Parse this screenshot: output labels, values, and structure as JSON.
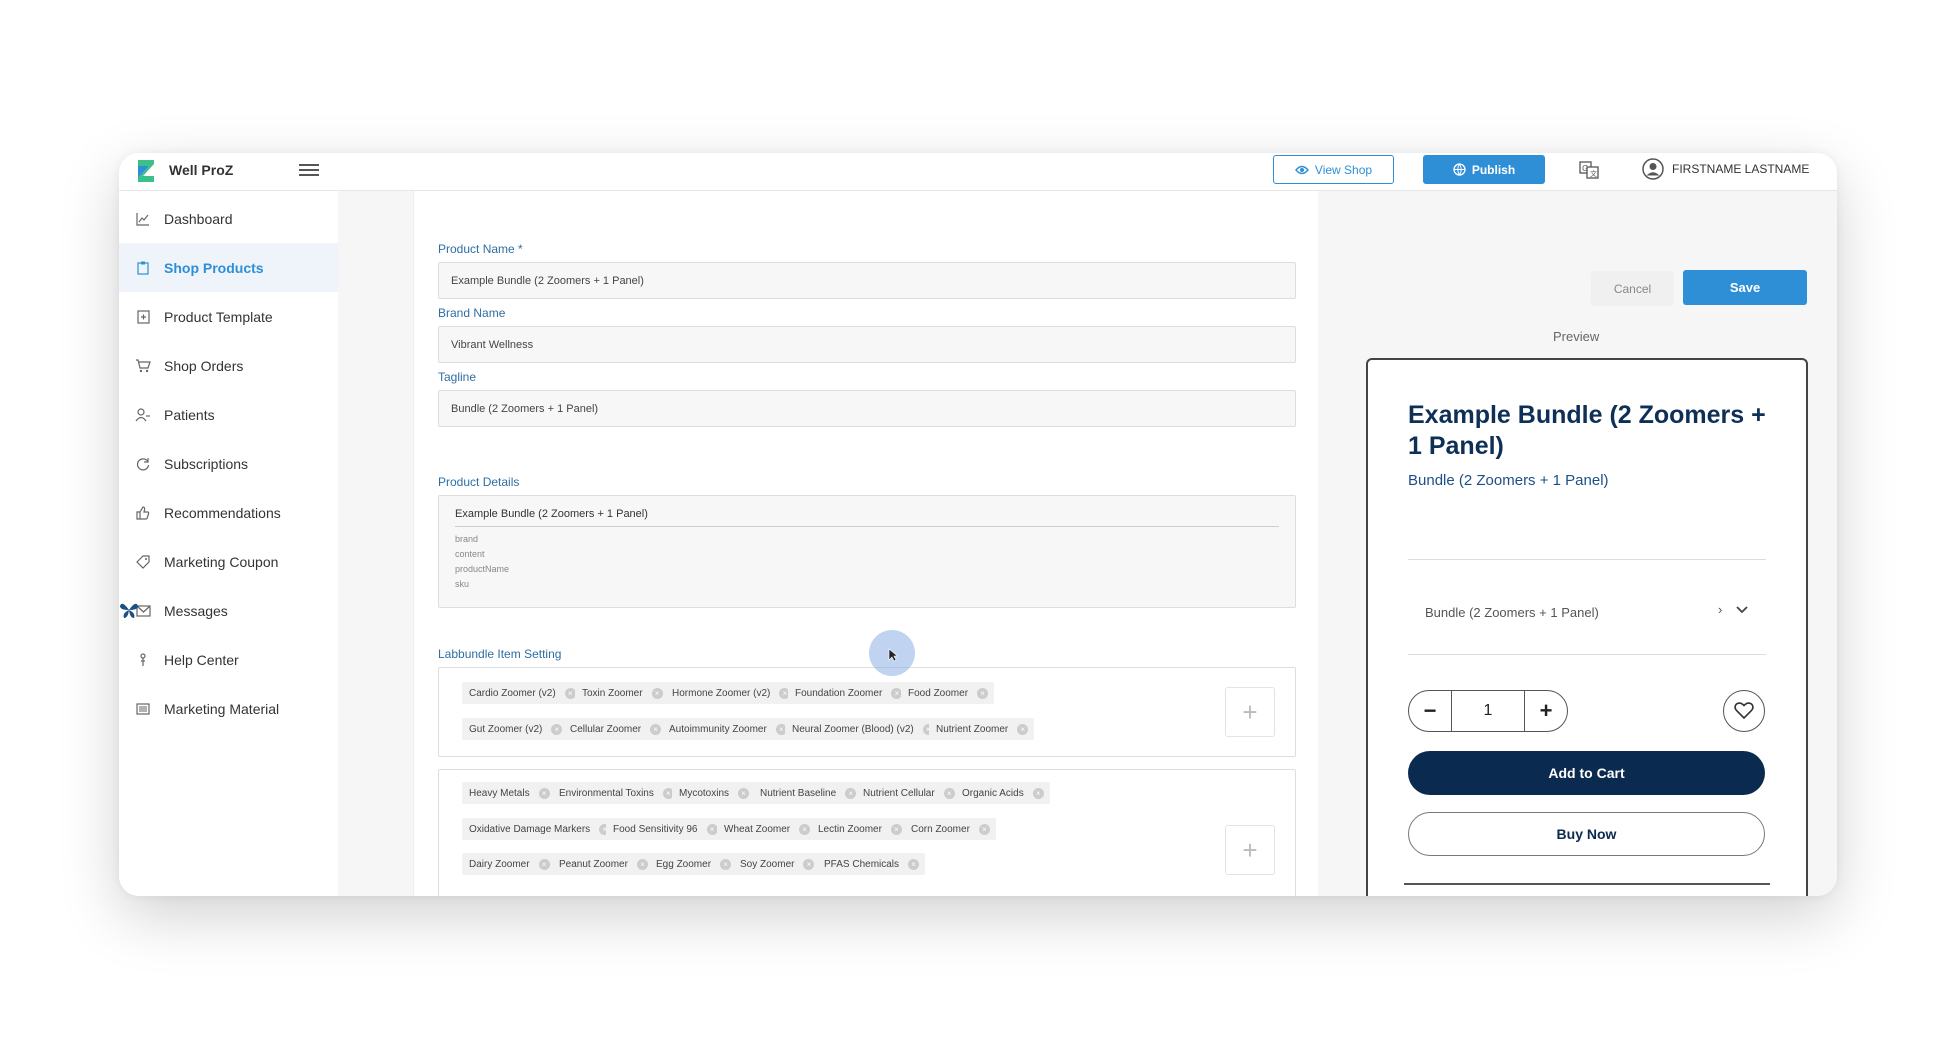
{
  "app": {
    "name": "Well ProZ"
  },
  "topbar": {
    "view_shop": "View Shop",
    "publish": "Publish",
    "user_name": "FIRSTNAME LASTNAME"
  },
  "sidebar": {
    "items": [
      {
        "label": "Dashboard",
        "icon": "chart-icon"
      },
      {
        "label": "Shop Products",
        "icon": "clipboard-icon",
        "active": true
      },
      {
        "label": "Product Template",
        "icon": "template-icon"
      },
      {
        "label": "Shop Orders",
        "icon": "cart-icon"
      },
      {
        "label": "Patients",
        "icon": "people-icon"
      },
      {
        "label": "Subscriptions",
        "icon": "refresh-icon"
      },
      {
        "label": "Recommendations",
        "icon": "thumbs-up-icon"
      },
      {
        "label": "Marketing Coupon",
        "icon": "tag-icon"
      },
      {
        "label": "Messages",
        "icon": "mail-icon"
      },
      {
        "label": "Help Center",
        "icon": "help-icon"
      },
      {
        "label": "Marketing Material",
        "icon": "list-icon"
      }
    ]
  },
  "form": {
    "product_name_label": "Product Name *",
    "product_name_value": "Example Bundle (2 Zoomers + 1 Panel)",
    "brand_name_label": "Brand Name",
    "brand_name_value": "Vibrant Wellness",
    "tagline_label": "Tagline",
    "tagline_value": "Bundle (2 Zoomers + 1 Panel)",
    "product_details_label": "Product Details",
    "product_details": {
      "line": "Example Bundle (2 Zoomers + 1 Panel)",
      "fields": [
        "brand",
        "content",
        "productName",
        "sku"
      ]
    },
    "labbundle_label": "Labbundle Item Setting",
    "group1": [
      "Cardio Zoomer (v2)",
      "Toxin Zoomer",
      "Hormone Zoomer (v2)",
      "Foundation Zoomer",
      "Food Zoomer",
      "Gut Zoomer (v2)",
      "Cellular Zoomer",
      "Autoimmunity Zoomer",
      "Neural Zoomer (Blood) (v2)",
      "Nutrient Zoomer"
    ],
    "group2": [
      "Heavy Metals",
      "Environmental Toxins",
      "Mycotoxins",
      "Nutrient Baseline",
      "Nutrient Cellular",
      "Organic Acids",
      "Oxidative Damage Markers",
      "Food Sensitivity 96",
      "Wheat Zoomer",
      "Lectin Zoomer",
      "Corn Zoomer",
      "Dairy Zoomer",
      "Peanut Zoomer",
      "Egg Zoomer",
      "Soy Zoomer",
      "PFAS Chemicals"
    ]
  },
  "actions": {
    "cancel": "Cancel",
    "save": "Save"
  },
  "preview": {
    "label": "Preview",
    "title": "Example Bundle (2 Zoomers + 1 Panel)",
    "subtitle": "Bundle (2 Zoomers + 1 Panel)",
    "variant": "Bundle (2 Zoomers + 1 Panel)",
    "quantity": "1",
    "add_to_cart": "Add to Cart",
    "buy_now": "Buy Now"
  },
  "colors": {
    "primary": "#2e8fd6",
    "navy": "#0b2a4f"
  }
}
